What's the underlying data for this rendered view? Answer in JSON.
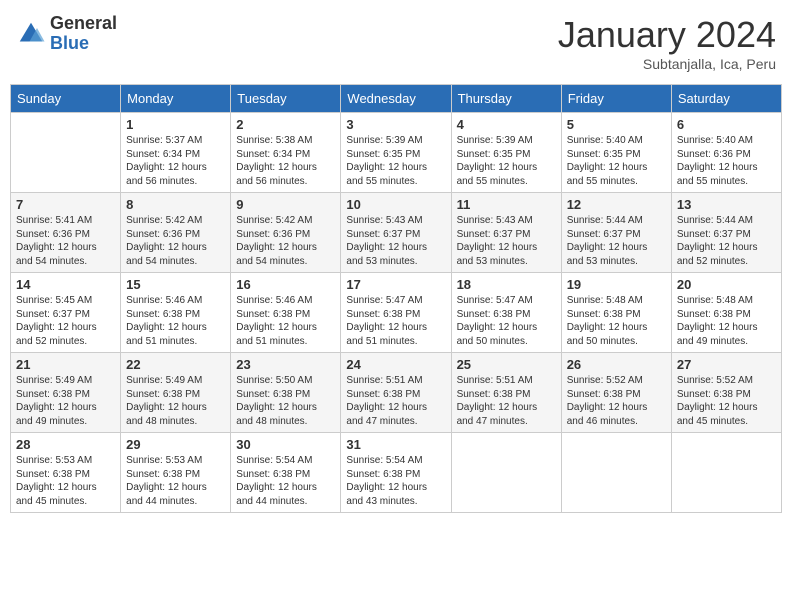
{
  "header": {
    "logo_general": "General",
    "logo_blue": "Blue",
    "month_title": "January 2024",
    "subtitle": "Subtanjalla, Ica, Peru"
  },
  "days_of_week": [
    "Sunday",
    "Monday",
    "Tuesday",
    "Wednesday",
    "Thursday",
    "Friday",
    "Saturday"
  ],
  "weeks": [
    [
      {
        "day": "",
        "info": ""
      },
      {
        "day": "1",
        "info": "Sunrise: 5:37 AM\nSunset: 6:34 PM\nDaylight: 12 hours\nand 56 minutes."
      },
      {
        "day": "2",
        "info": "Sunrise: 5:38 AM\nSunset: 6:34 PM\nDaylight: 12 hours\nand 56 minutes."
      },
      {
        "day": "3",
        "info": "Sunrise: 5:39 AM\nSunset: 6:35 PM\nDaylight: 12 hours\nand 55 minutes."
      },
      {
        "day": "4",
        "info": "Sunrise: 5:39 AM\nSunset: 6:35 PM\nDaylight: 12 hours\nand 55 minutes."
      },
      {
        "day": "5",
        "info": "Sunrise: 5:40 AM\nSunset: 6:35 PM\nDaylight: 12 hours\nand 55 minutes."
      },
      {
        "day": "6",
        "info": "Sunrise: 5:40 AM\nSunset: 6:36 PM\nDaylight: 12 hours\nand 55 minutes."
      }
    ],
    [
      {
        "day": "7",
        "info": "Sunrise: 5:41 AM\nSunset: 6:36 PM\nDaylight: 12 hours\nand 54 minutes."
      },
      {
        "day": "8",
        "info": "Sunrise: 5:42 AM\nSunset: 6:36 PM\nDaylight: 12 hours\nand 54 minutes."
      },
      {
        "day": "9",
        "info": "Sunrise: 5:42 AM\nSunset: 6:36 PM\nDaylight: 12 hours\nand 54 minutes."
      },
      {
        "day": "10",
        "info": "Sunrise: 5:43 AM\nSunset: 6:37 PM\nDaylight: 12 hours\nand 53 minutes."
      },
      {
        "day": "11",
        "info": "Sunrise: 5:43 AM\nSunset: 6:37 PM\nDaylight: 12 hours\nand 53 minutes."
      },
      {
        "day": "12",
        "info": "Sunrise: 5:44 AM\nSunset: 6:37 PM\nDaylight: 12 hours\nand 53 minutes."
      },
      {
        "day": "13",
        "info": "Sunrise: 5:44 AM\nSunset: 6:37 PM\nDaylight: 12 hours\nand 52 minutes."
      }
    ],
    [
      {
        "day": "14",
        "info": "Sunrise: 5:45 AM\nSunset: 6:37 PM\nDaylight: 12 hours\nand 52 minutes."
      },
      {
        "day": "15",
        "info": "Sunrise: 5:46 AM\nSunset: 6:38 PM\nDaylight: 12 hours\nand 51 minutes."
      },
      {
        "day": "16",
        "info": "Sunrise: 5:46 AM\nSunset: 6:38 PM\nDaylight: 12 hours\nand 51 minutes."
      },
      {
        "day": "17",
        "info": "Sunrise: 5:47 AM\nSunset: 6:38 PM\nDaylight: 12 hours\nand 51 minutes."
      },
      {
        "day": "18",
        "info": "Sunrise: 5:47 AM\nSunset: 6:38 PM\nDaylight: 12 hours\nand 50 minutes."
      },
      {
        "day": "19",
        "info": "Sunrise: 5:48 AM\nSunset: 6:38 PM\nDaylight: 12 hours\nand 50 minutes."
      },
      {
        "day": "20",
        "info": "Sunrise: 5:48 AM\nSunset: 6:38 PM\nDaylight: 12 hours\nand 49 minutes."
      }
    ],
    [
      {
        "day": "21",
        "info": "Sunrise: 5:49 AM\nSunset: 6:38 PM\nDaylight: 12 hours\nand 49 minutes."
      },
      {
        "day": "22",
        "info": "Sunrise: 5:49 AM\nSunset: 6:38 PM\nDaylight: 12 hours\nand 48 minutes."
      },
      {
        "day": "23",
        "info": "Sunrise: 5:50 AM\nSunset: 6:38 PM\nDaylight: 12 hours\nand 48 minutes."
      },
      {
        "day": "24",
        "info": "Sunrise: 5:51 AM\nSunset: 6:38 PM\nDaylight: 12 hours\nand 47 minutes."
      },
      {
        "day": "25",
        "info": "Sunrise: 5:51 AM\nSunset: 6:38 PM\nDaylight: 12 hours\nand 47 minutes."
      },
      {
        "day": "26",
        "info": "Sunrise: 5:52 AM\nSunset: 6:38 PM\nDaylight: 12 hours\nand 46 minutes."
      },
      {
        "day": "27",
        "info": "Sunrise: 5:52 AM\nSunset: 6:38 PM\nDaylight: 12 hours\nand 45 minutes."
      }
    ],
    [
      {
        "day": "28",
        "info": "Sunrise: 5:53 AM\nSunset: 6:38 PM\nDaylight: 12 hours\nand 45 minutes."
      },
      {
        "day": "29",
        "info": "Sunrise: 5:53 AM\nSunset: 6:38 PM\nDaylight: 12 hours\nand 44 minutes."
      },
      {
        "day": "30",
        "info": "Sunrise: 5:54 AM\nSunset: 6:38 PM\nDaylight: 12 hours\nand 44 minutes."
      },
      {
        "day": "31",
        "info": "Sunrise: 5:54 AM\nSunset: 6:38 PM\nDaylight: 12 hours\nand 43 minutes."
      },
      {
        "day": "",
        "info": ""
      },
      {
        "day": "",
        "info": ""
      },
      {
        "day": "",
        "info": ""
      }
    ]
  ]
}
